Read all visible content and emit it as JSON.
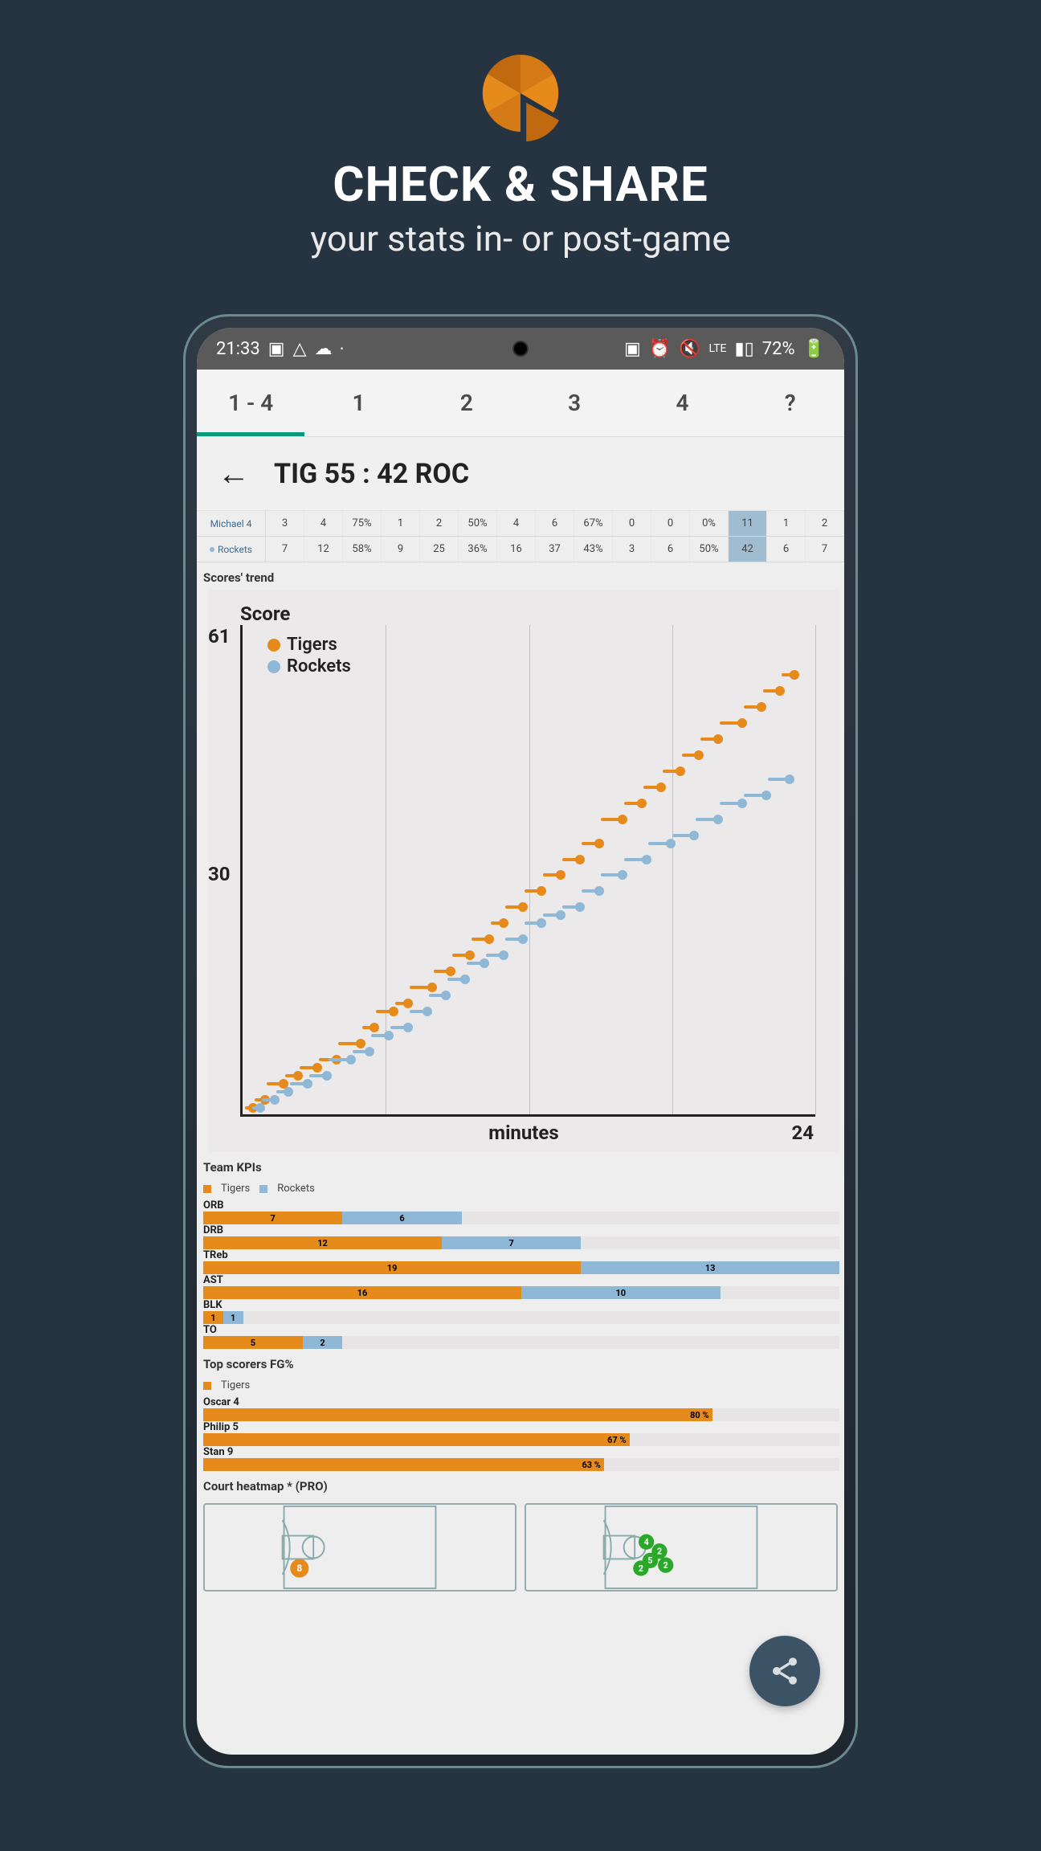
{
  "hero": {
    "title": "CHECK & SHARE",
    "subtitle": "your stats in- or post-game"
  },
  "statusbar": {
    "time": "21:33",
    "net_label": "LTE",
    "battery": "72%"
  },
  "tabs": [
    "1 - 4",
    "1",
    "2",
    "3",
    "4",
    "?"
  ],
  "active_tab_index": 0,
  "score_header": "TIG 55 : 42 ROC",
  "stat_rows": [
    {
      "label": "Michael 4",
      "dot": false,
      "cells": [
        "3",
        "4",
        "75%",
        "1",
        "2",
        "50%",
        "4",
        "6",
        "67%",
        "0",
        "0",
        "0%",
        "11",
        "1",
        "2"
      ],
      "highlight_col": 12
    },
    {
      "label": "Rockets",
      "dot": true,
      "cells": [
        "7",
        "12",
        "58%",
        "9",
        "25",
        "36%",
        "16",
        "37",
        "43%",
        "3",
        "6",
        "50%",
        "42",
        "6",
        "7"
      ],
      "highlight_col": 12
    }
  ],
  "sections": {
    "trend": "Scores' trend",
    "kpi": "Team KPIs",
    "top": "Top scorers FG%",
    "court": "Court heatmap  *  (PRO)"
  },
  "colors": {
    "orange": "#e58a1b",
    "blue": "#8fb7d6",
    "accent_teal": "#099a7c",
    "fab": "#3b5365"
  },
  "chart_data": {
    "type": "line",
    "title": "Score",
    "xlabel": "minutes",
    "ylabel": "Score",
    "xlim": [
      0,
      24
    ],
    "ylim": [
      0,
      61
    ],
    "y_ticks": [
      30,
      61
    ],
    "x_ticks": [
      24
    ],
    "legend": [
      "Tigers",
      "Rockets"
    ],
    "series": [
      {
        "name": "Tigers",
        "color": "#e58a1b",
        "x": [
          0.5,
          1,
          1.8,
          2.4,
          3.2,
          4,
          5,
          5.6,
          6.4,
          7,
          8,
          8.8,
          9.6,
          10.4,
          11,
          11.8,
          12.6,
          13.4,
          14.2,
          15,
          16,
          16.8,
          17.6,
          18.4,
          19.2,
          20,
          21,
          21.8,
          22.6,
          23.2
        ],
        "values": [
          1,
          2,
          4,
          5,
          6,
          7,
          9,
          11,
          13,
          14,
          16,
          18,
          20,
          22,
          24,
          26,
          28,
          30,
          32,
          34,
          37,
          39,
          41,
          43,
          45,
          47,
          49,
          51,
          53,
          55
        ]
      },
      {
        "name": "Rockets",
        "color": "#8fb7d6",
        "x": [
          0.8,
          1.4,
          2,
          2.8,
          3.6,
          4.6,
          5.4,
          6.2,
          7,
          7.8,
          8.6,
          9.4,
          10.2,
          11,
          11.8,
          12.6,
          13.4,
          14.2,
          15,
          16,
          17,
          18,
          19,
          20,
          21,
          22,
          23
        ],
        "values": [
          1,
          2,
          3,
          4,
          5,
          7,
          8,
          10,
          11,
          13,
          15,
          17,
          19,
          20,
          22,
          24,
          25,
          26,
          28,
          30,
          32,
          34,
          35,
          37,
          39,
          40,
          42
        ]
      }
    ]
  },
  "kpi_legend": [
    "Tigers",
    "Rockets"
  ],
  "kpi_metrics": [
    {
      "label": "ORB",
      "tigers": 7,
      "rockets": 6
    },
    {
      "label": "DRB",
      "tigers": 12,
      "rockets": 7
    },
    {
      "label": "TReb",
      "tigers": 19,
      "rockets": 13
    },
    {
      "label": "AST",
      "tigers": 16,
      "rockets": 10
    },
    {
      "label": "BLK",
      "tigers": 1,
      "rockets": 1
    },
    {
      "label": "TO",
      "tigers": 5,
      "rockets": 2
    }
  ],
  "top_scorers_legend": "Tigers",
  "top_scorers": [
    {
      "name": "Oscar 4",
      "pct": 80
    },
    {
      "name": "Philip 5",
      "pct": 67
    },
    {
      "name": "Stan 9",
      "pct": 63
    }
  ]
}
